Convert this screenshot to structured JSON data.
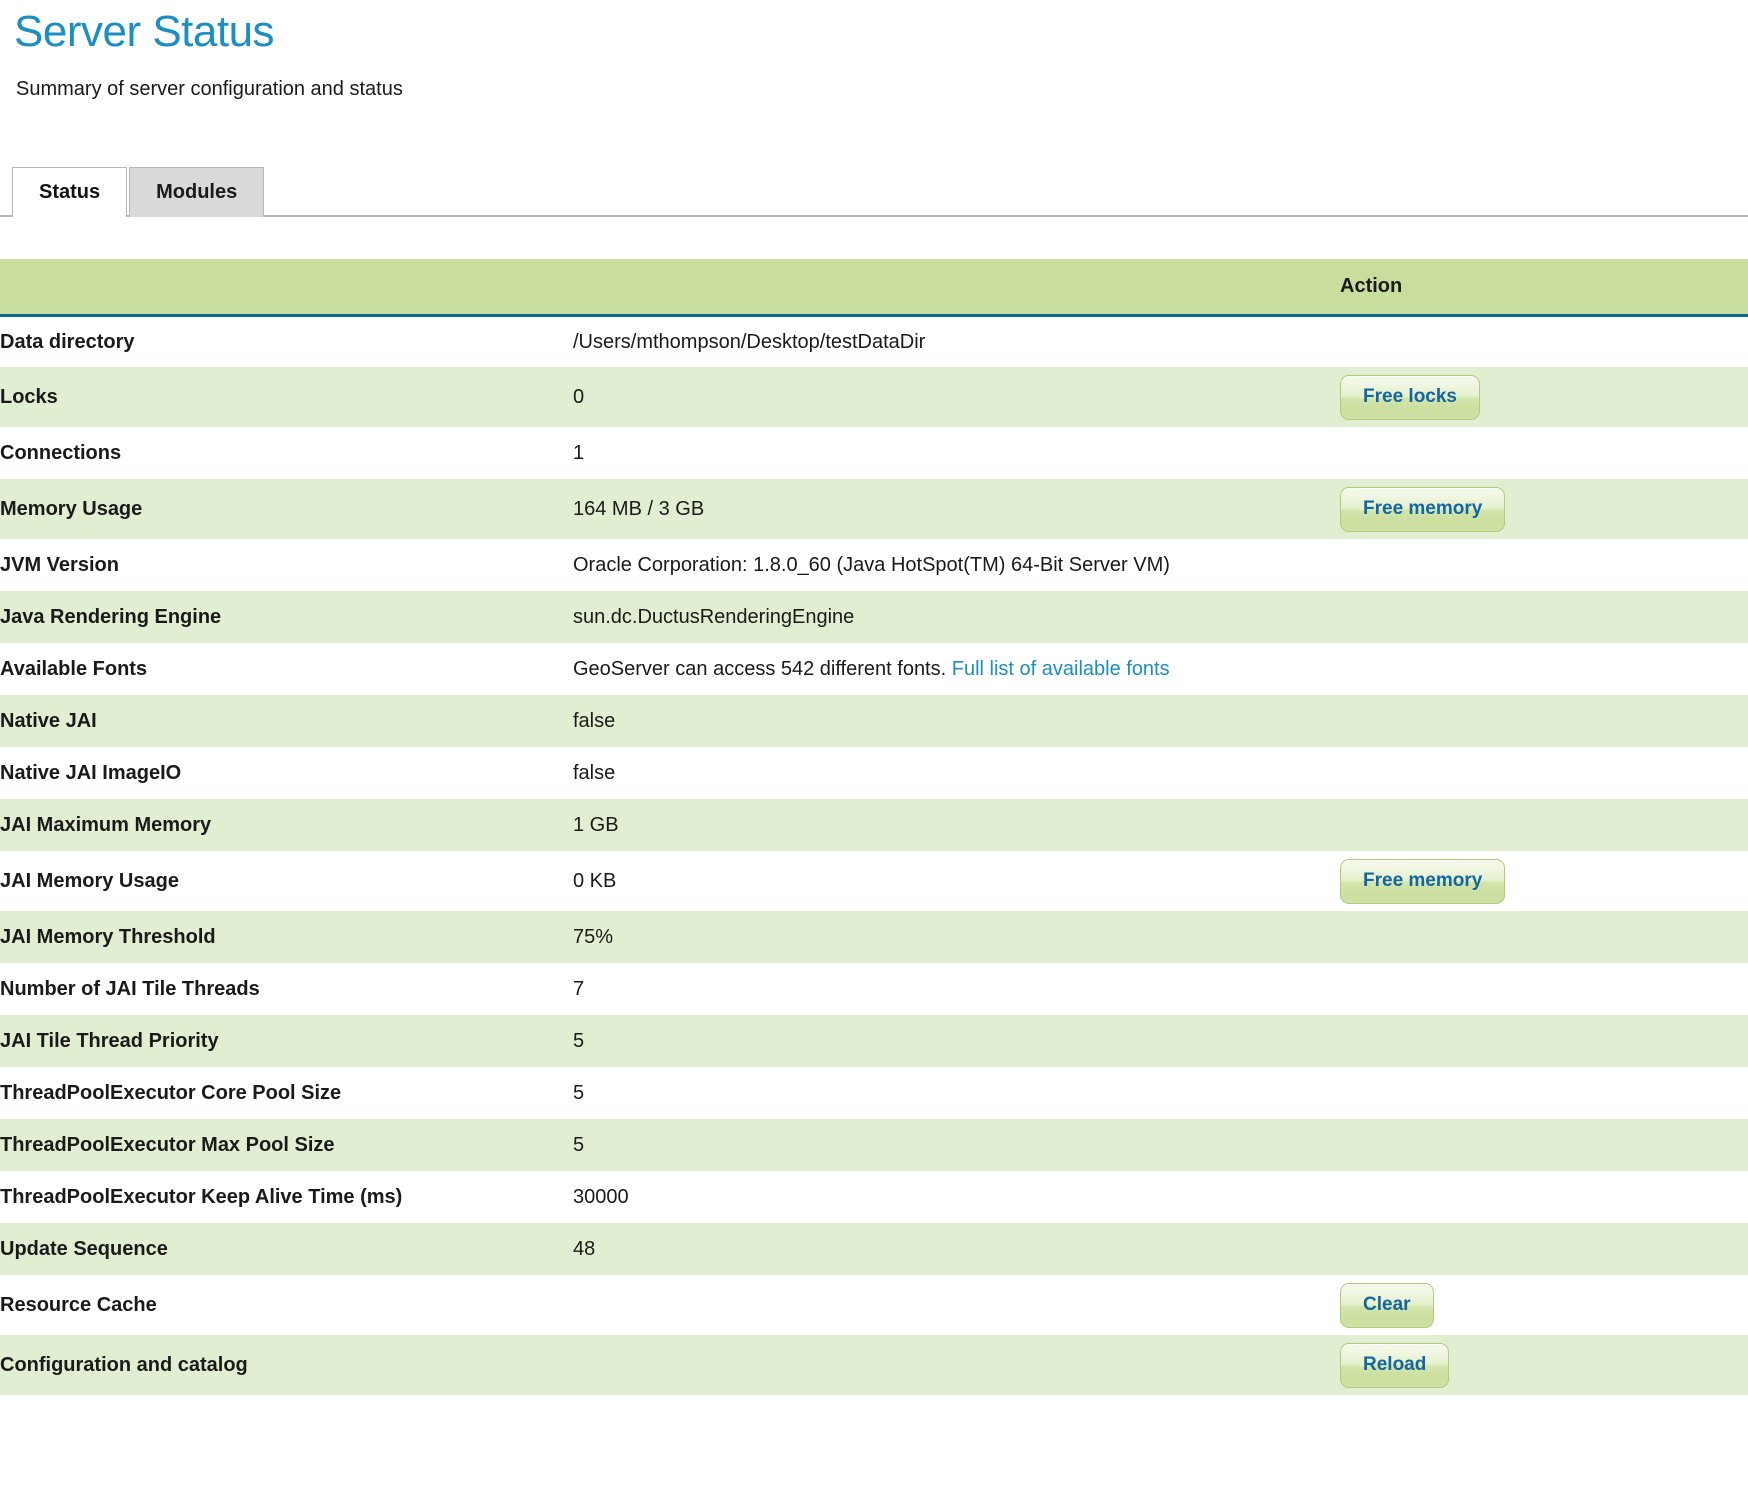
{
  "header": {
    "title": "Server Status",
    "subtitle": "Summary of server configuration and status"
  },
  "tabs": [
    {
      "label": "Status",
      "active": true
    },
    {
      "label": "Modules",
      "active": false
    }
  ],
  "table": {
    "columns": {
      "label": "",
      "value": "",
      "action": "Action"
    },
    "rows": [
      {
        "label": "Data directory",
        "value": "/Users/mthompson/Desktop/testDataDir",
        "action": null
      },
      {
        "label": "Locks",
        "value": "0",
        "action": "Free locks"
      },
      {
        "label": "Connections",
        "value": "1",
        "action": null
      },
      {
        "label": "Memory Usage",
        "value": "164 MB / 3 GB",
        "action": "Free memory"
      },
      {
        "label": "JVM Version",
        "value": "Oracle Corporation: 1.8.0_60 (Java HotSpot(TM) 64-Bit Server VM)",
        "action": null
      },
      {
        "label": "Java Rendering Engine",
        "value": "sun.dc.DuctusRenderingEngine",
        "action": null
      },
      {
        "label": "Available Fonts",
        "value": "GeoServer can access 542 different fonts. ",
        "link": "Full list of available fonts",
        "action": null
      },
      {
        "label": "Native JAI",
        "value": "false",
        "action": null
      },
      {
        "label": "Native JAI ImageIO",
        "value": "false",
        "action": null
      },
      {
        "label": "JAI Maximum Memory",
        "value": "1 GB",
        "action": null
      },
      {
        "label": "JAI Memory Usage",
        "value": "0 KB",
        "action": "Free memory"
      },
      {
        "label": "JAI Memory Threshold",
        "value": "75%",
        "action": null
      },
      {
        "label": "Number of JAI Tile Threads",
        "value": "7",
        "action": null
      },
      {
        "label": "JAI Tile Thread Priority",
        "value": "5",
        "action": null
      },
      {
        "label": "ThreadPoolExecutor Core Pool Size",
        "value": "5",
        "action": null
      },
      {
        "label": "ThreadPoolExecutor Max Pool Size",
        "value": "5",
        "action": null
      },
      {
        "label": "ThreadPoolExecutor Keep Alive Time (ms)",
        "value": "30000",
        "action": null
      },
      {
        "label": "Update Sequence",
        "value": "48",
        "action": null
      },
      {
        "label": "Resource Cache",
        "value": "",
        "action": "Clear"
      },
      {
        "label": "Configuration and catalog",
        "value": "",
        "action": "Reload"
      }
    ]
  },
  "colors": {
    "title_blue": "#1c8ec1",
    "header_green": "#c9dd9d",
    "row_green": "#e1eed1",
    "header_rule": "#0a6c92",
    "button_text": "#1565a0",
    "link": "#1c8ec1"
  }
}
